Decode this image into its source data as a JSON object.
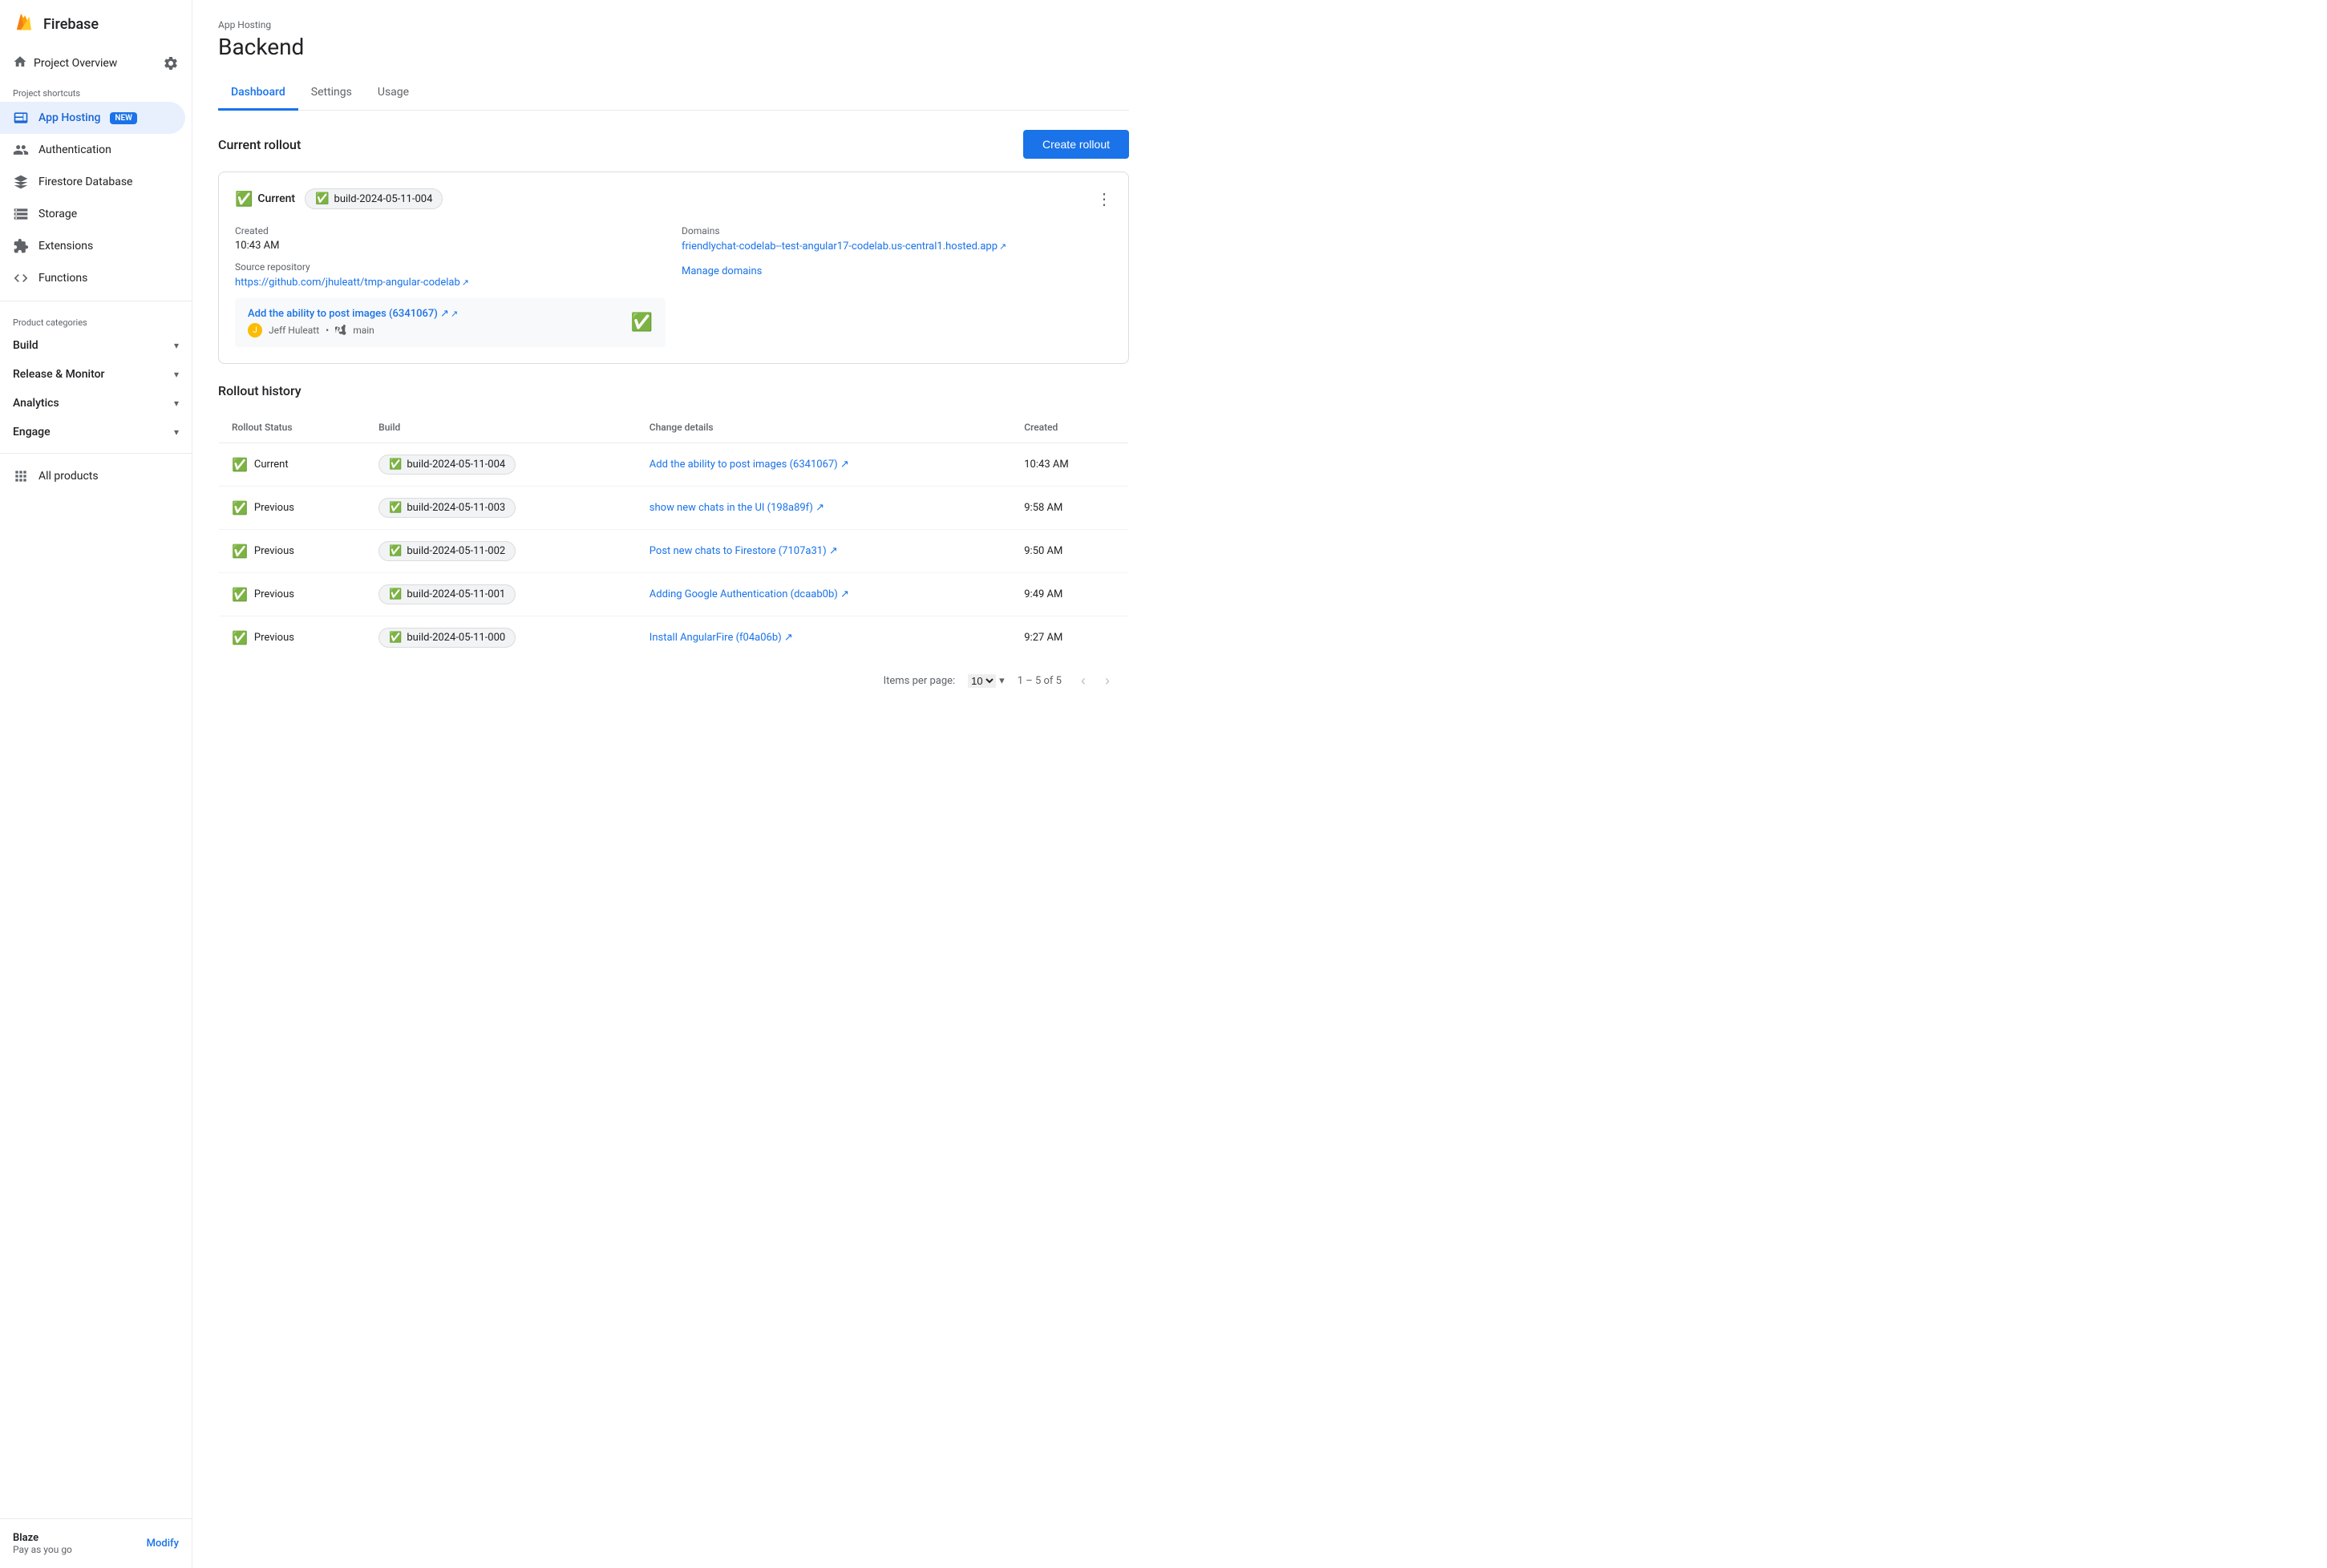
{
  "app": {
    "title": "Firebase"
  },
  "sidebar": {
    "project": {
      "name": "Project Overview"
    },
    "shortcuts_label": "Project shortcuts",
    "items": [
      {
        "id": "app-hosting",
        "label": "App Hosting",
        "badge": "NEW",
        "active": true
      },
      {
        "id": "authentication",
        "label": "Authentication",
        "active": false
      },
      {
        "id": "firestore",
        "label": "Firestore Database",
        "active": false
      },
      {
        "id": "storage",
        "label": "Storage",
        "active": false
      },
      {
        "id": "extensions",
        "label": "Extensions",
        "active": false
      },
      {
        "id": "functions",
        "label": "Functions",
        "active": false
      }
    ],
    "categories_label": "Product categories",
    "categories": [
      {
        "id": "build",
        "label": "Build"
      },
      {
        "id": "release-monitor",
        "label": "Release & Monitor"
      },
      {
        "id": "analytics",
        "label": "Analytics"
      },
      {
        "id": "engage",
        "label": "Engage"
      }
    ],
    "all_products": "All products",
    "footer": {
      "plan_name": "Blaze",
      "plan_sub": "Pay as you go",
      "modify_label": "Modify"
    }
  },
  "main": {
    "subtitle": "App Hosting",
    "title": "Backend",
    "tabs": [
      {
        "id": "dashboard",
        "label": "Dashboard",
        "active": true
      },
      {
        "id": "settings",
        "label": "Settings",
        "active": false
      },
      {
        "id": "usage",
        "label": "Usage",
        "active": false
      }
    ],
    "create_rollout_btn": "Create rollout",
    "current_rollout": {
      "section_title": "Current rollout",
      "status": "Current",
      "build": "build-2024-05-11-004",
      "created_label": "Created",
      "created_value": "10:43 AM",
      "source_label": "Source repository",
      "source_url": "https://github.com/jhuleatt/tmp-angular-codelab",
      "source_text": "https://github.com/jhuleatt/tmp-angular-codelab ↗",
      "domains_label": "Domains",
      "domains_url": "friendlychat-codelab--test-angular17-codelab.us-central1.hosted.app",
      "domains_text": "friendlychat-codelab--test-angular17-codelab.us-central1.hosted.app ↗",
      "commit_title": "Add the ability to post images (6341067) ↗",
      "commit_author": "Jeff Huleatt",
      "commit_branch": "main",
      "manage_domains": "Manage domains"
    },
    "rollout_history": {
      "section_title": "Rollout history",
      "columns": [
        "Rollout Status",
        "Build",
        "Change details",
        "Created"
      ],
      "rows": [
        {
          "status": "Current",
          "build": "build-2024-05-11-004",
          "change": "Add the ability to post images (6341067) ↗",
          "created": "10:43 AM"
        },
        {
          "status": "Previous",
          "build": "build-2024-05-11-003",
          "change": "show new chats in the UI (198a89f) ↗",
          "created": "9:58 AM"
        },
        {
          "status": "Previous",
          "build": "build-2024-05-11-002",
          "change": "Post new chats to Firestore (7107a31) ↗",
          "created": "9:50 AM"
        },
        {
          "status": "Previous",
          "build": "build-2024-05-11-001",
          "change": "Adding Google Authentication (dcaab0b) ↗",
          "created": "9:49 AM"
        },
        {
          "status": "Previous",
          "build": "build-2024-05-11-000",
          "change": "Install AngularFire (f04a06b) ↗",
          "created": "9:27 AM"
        }
      ],
      "pagination": {
        "items_per_page_label": "Items per page:",
        "items_per_page_value": "10",
        "range": "1 – 5 of 5"
      }
    }
  }
}
